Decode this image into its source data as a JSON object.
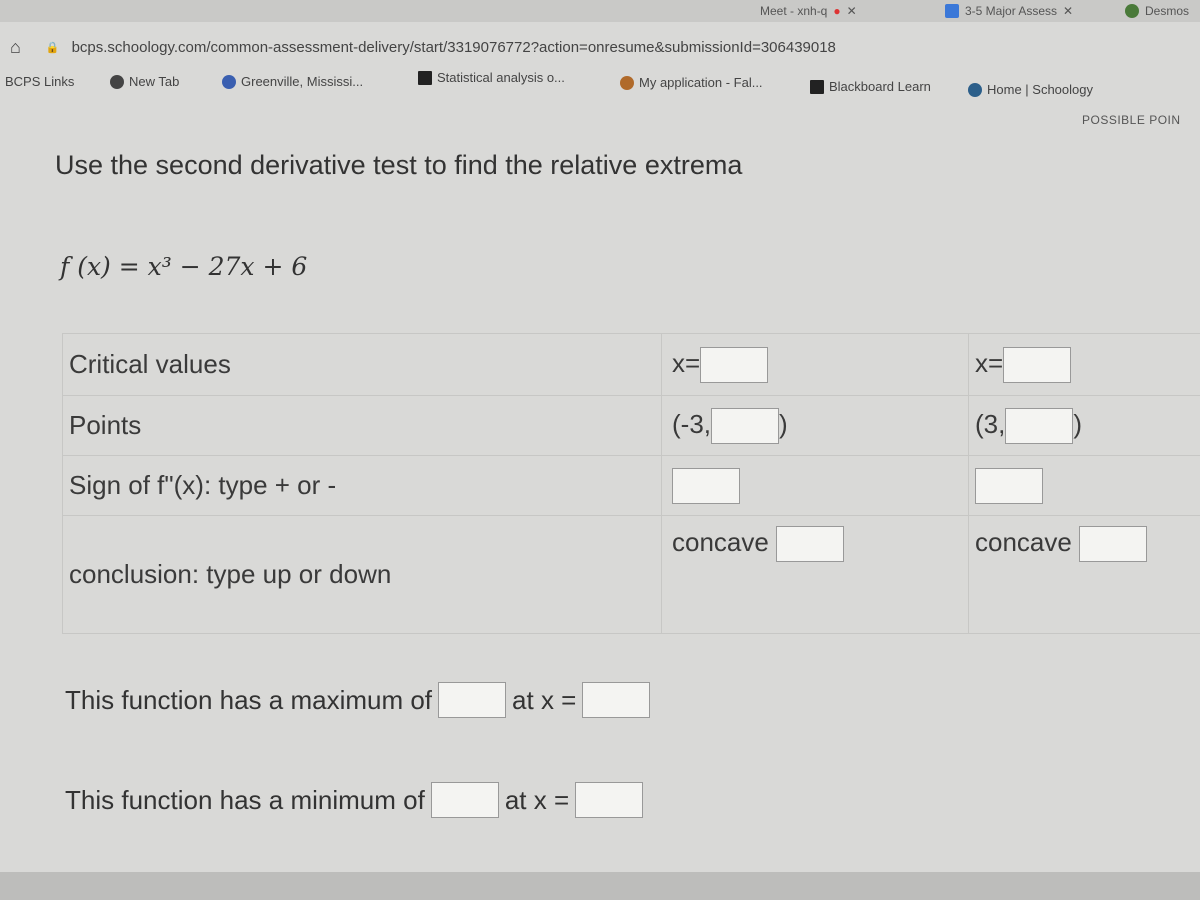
{
  "browser": {
    "tabs": [
      {
        "label": "Meet - xnh-q"
      },
      {
        "label": "3-5 Major Assess"
      },
      {
        "label": "Desmos"
      }
    ],
    "url": "bcps.schoology.com/common-assessment-delivery/start/3319076772?action=onresume&submissionId=306439018",
    "bookmarks": [
      {
        "label": "BCPS Links"
      },
      {
        "label": "New Tab"
      },
      {
        "label": "Greenville, Mississi..."
      },
      {
        "label": "Statistical analysis o..."
      },
      {
        "label": "My application - Fal..."
      },
      {
        "label": "Blackboard Learn"
      },
      {
        "label": "Home | Schoology"
      }
    ]
  },
  "header": {
    "possible_points": "POSSIBLE POIN"
  },
  "question": {
    "prompt": "Use the second derivative test to find the relative extrema",
    "function": "f (x) = x³ − 27x + 6"
  },
  "table": {
    "rows": [
      {
        "label": "Critical values",
        "c1_prefix": "x=",
        "c2_prefix": "x="
      },
      {
        "label": "Points",
        "c1_prefix": "(-3,",
        "c1_suffix": ")",
        "c2_prefix": "(3,",
        "c2_suffix": ")"
      },
      {
        "label": "Sign of f\"(x):  type + or -"
      },
      {
        "label": "conclusion:  type up or down",
        "c1_prefix": "concave",
        "c2_prefix": "concave"
      }
    ]
  },
  "maximum": {
    "text": "This function has a maximum of",
    "at": "at x ="
  },
  "minimum": {
    "text": "This function has a minimum of",
    "at": "at x ="
  }
}
